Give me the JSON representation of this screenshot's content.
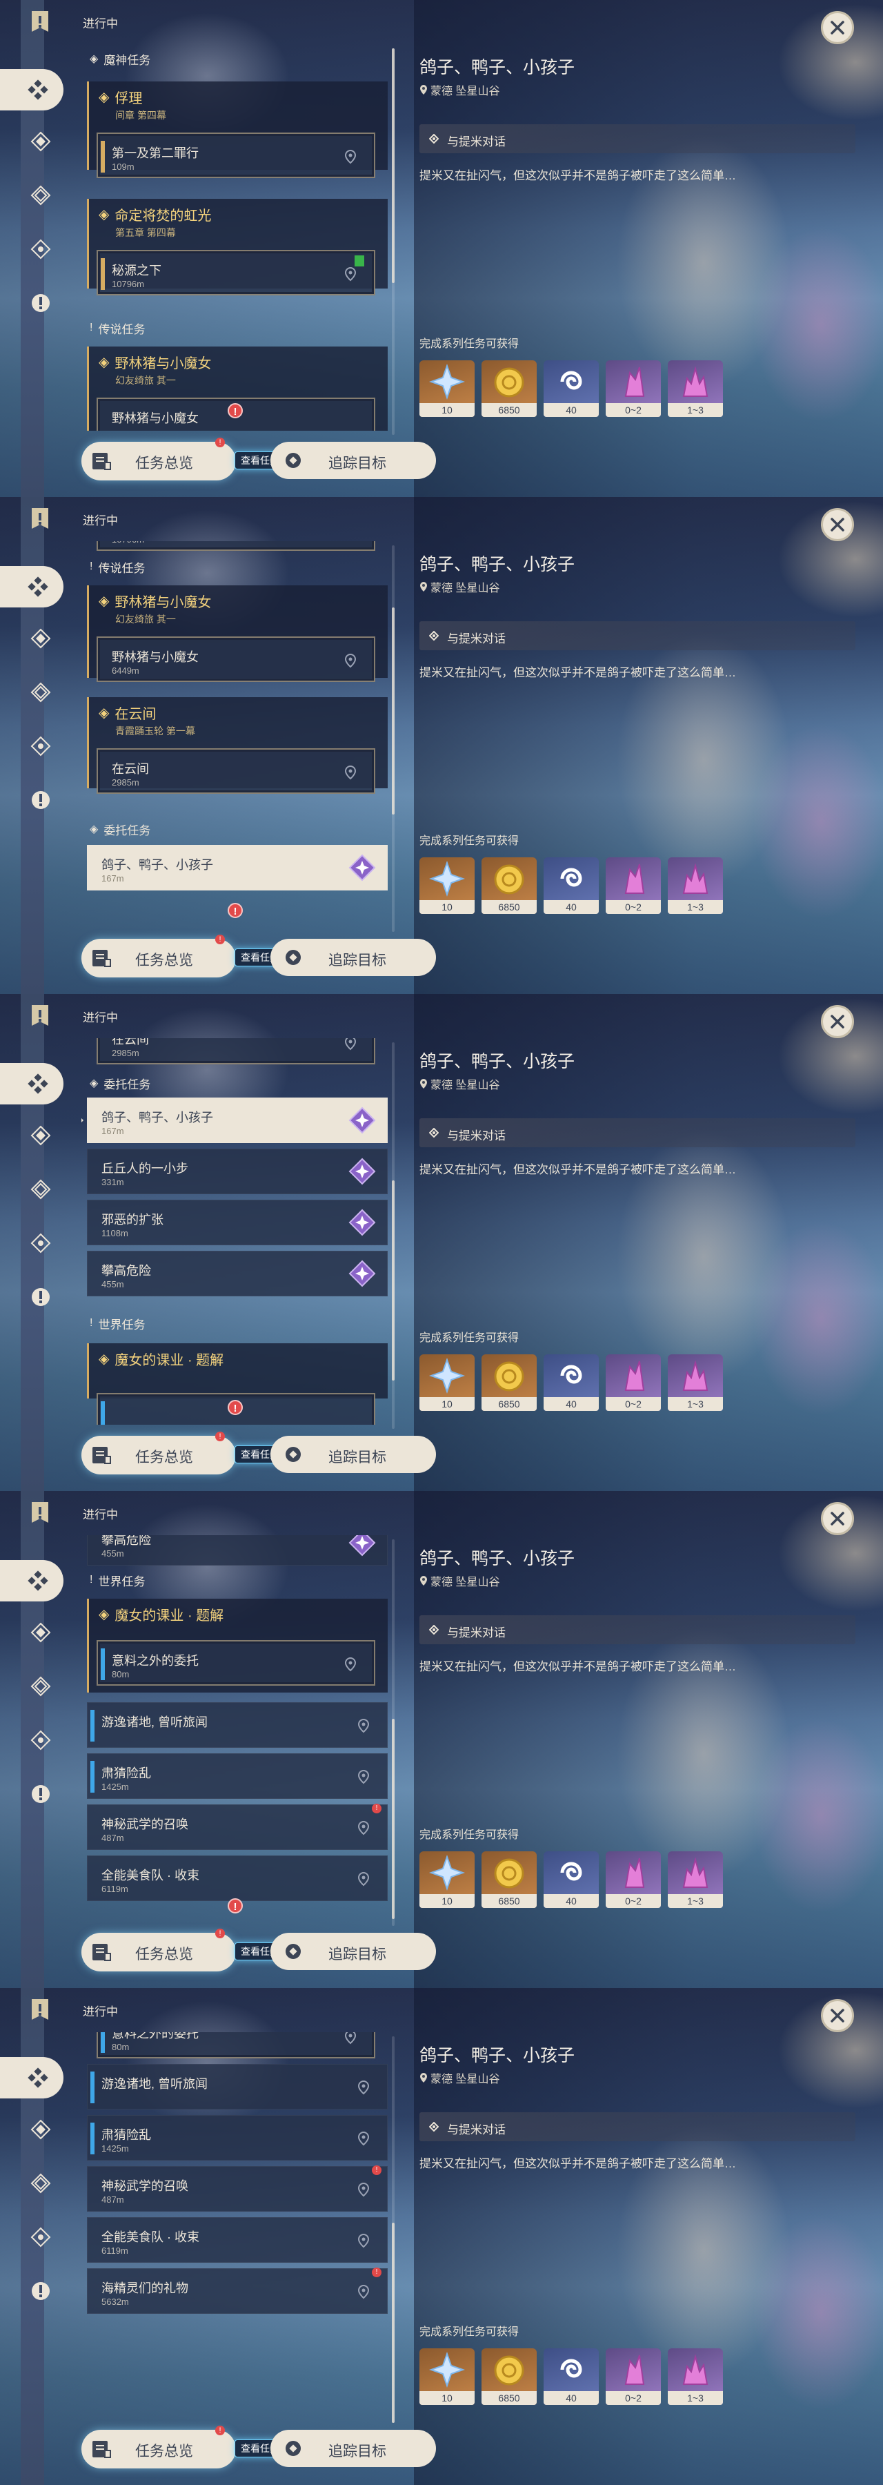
{
  "header": {
    "in_progress": "进行中"
  },
  "detail": {
    "title": "鸽子、鸭子、小孩子",
    "location": "蒙德 坠星山谷",
    "objective": "与提米对话",
    "description": "提米又在扯闪气，但这次似乎并不是鸽子被吓走了这么简单…",
    "rewards_label": "完成系列任务可获得",
    "rewards": [
      {
        "icon": "adventure-exp-icon",
        "count": "10"
      },
      {
        "icon": "mora-icon",
        "count": "6850"
      },
      {
        "icon": "companionship-exp-icon",
        "count": "40"
      },
      {
        "icon": "crystal-chunk-icon",
        "count": "0~2"
      },
      {
        "icon": "crystal-cluster-icon",
        "count": "1~3"
      }
    ],
    "track_label": "追踪目标"
  },
  "overview": {
    "label": "任务总览",
    "tooltip": "查看任务总览",
    "badge": "!"
  },
  "sections": {
    "archon": "魔神任务",
    "story": "传说任务",
    "commission": "委托任务",
    "world": "世界任务"
  },
  "quests": {
    "archon1": {
      "title": "俘理",
      "sub": "间章 第四幕"
    },
    "archon1_step": {
      "title": "第一及第二罪行",
      "dist": "109m"
    },
    "archon2": {
      "title": "命定将焚的虹光",
      "sub": "第五章 第四幕"
    },
    "archon2_step": {
      "title": "秘源之下",
      "dist": "10796m"
    },
    "story1": {
      "title": "野林猪与小魔女",
      "sub": "幻友绮旅 其一"
    },
    "story1_step": {
      "title": "野林猪与小魔女",
      "dist": "6449m"
    },
    "story2": {
      "title": "在云间",
      "sub": "青霞踊玉轮 第一幕"
    },
    "story2_step": {
      "title": "在云间",
      "dist": "2985m"
    },
    "commission1": {
      "title": "鸽子、鸭子、小孩子",
      "dist": "167m"
    },
    "commission2": {
      "title": "丘丘人的一小步",
      "dist": "331m"
    },
    "commission3": {
      "title": "邪恶的扩张",
      "dist": "1108m"
    },
    "commission4": {
      "title": "攀高危险",
      "dist": "455m"
    },
    "world1": {
      "title": "魔女的课业 · 题解"
    },
    "world1_step": {
      "title": "意料之外的委托",
      "dist": "80m"
    },
    "world2": {
      "title": "游逸诸地, 曾听旅闻"
    },
    "world3": {
      "title": "肃猜险乱",
      "dist": "1425m"
    },
    "world4": {
      "title": "神秘武学的召唤",
      "dist": "487m"
    },
    "world5": {
      "title": "全能美食队 · 收束",
      "dist": "6119m"
    },
    "world6": {
      "title": "海精灵们的礼物",
      "dist": "5632m"
    }
  },
  "colors": {
    "accent_gold": "#f3d27d",
    "cream": "#ece5d8",
    "alert_red": "#e24a4a",
    "track_blue": "#3fa7e8"
  }
}
